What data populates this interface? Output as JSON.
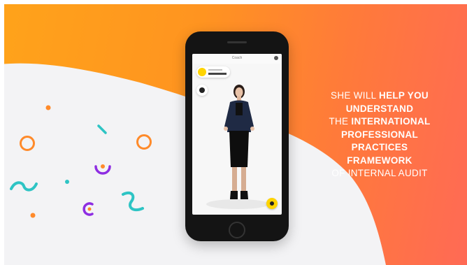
{
  "phone": {
    "screen_title": "Coach",
    "chip_subtitle": "",
    "chip_name": ""
  },
  "caption": {
    "line1_normal": "SHE WILL ",
    "line1_bold": "HELP YOU",
    "line2_bold": "UNDERSTAND",
    "line3_normal": "THE ",
    "line3_bold": "INTERNATIONAL",
    "line4_bold": "PROFESSIONAL",
    "line5_bold": "PRACTICES",
    "line6_bold": "FRAMEWORK",
    "line7_normal": "OF INTERNAL AUDIT"
  },
  "colors": {
    "background_orange": "#ff9420",
    "background_pink": "#ff6a55",
    "accent_yellow": "#ffd400",
    "confetti_orange": "#ff8a2a",
    "confetti_teal": "#2ec4c4",
    "confetti_purple": "#8e2de2"
  },
  "icons": [
    "microphone-icon",
    "menu-icon",
    "avatar-icon",
    "action-icon"
  ]
}
